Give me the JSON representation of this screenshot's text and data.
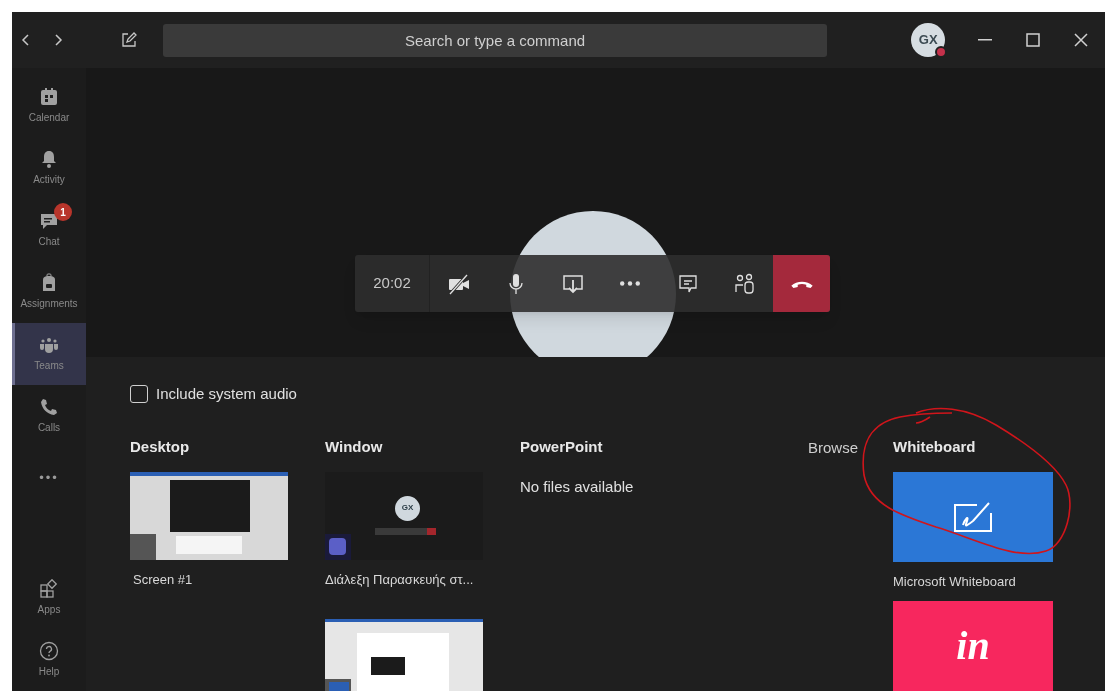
{
  "title_bar": {
    "search": {
      "placeholder": "Search or type a command"
    },
    "avatar": {
      "initials": "GX"
    }
  },
  "sidebar": {
    "items": [
      {
        "label": "Calendar",
        "selected": false
      },
      {
        "label": "Activity",
        "selected": false
      },
      {
        "label": "Chat",
        "selected": false,
        "badge": "1"
      },
      {
        "label": "Assignments",
        "selected": false
      },
      {
        "label": "Teams",
        "selected": true
      },
      {
        "label": "Calls",
        "selected": false
      },
      {
        "label": "•••",
        "selected": false
      }
    ],
    "bottom_items": [
      {
        "label": "Apps"
      },
      {
        "label": "Help"
      }
    ]
  },
  "call": {
    "toolbar": {
      "timer": "20:02",
      "buttons": [
        {
          "kind": "camera",
          "off": true
        },
        {
          "kind": "mic",
          "off": false
        },
        {
          "kind": "share"
        },
        {
          "kind": "more"
        },
        {
          "kind": "chat"
        },
        {
          "kind": "people"
        },
        {
          "kind": "hangup"
        }
      ]
    }
  },
  "share_tray": {
    "include_system_audio": {
      "label": "Include system audio",
      "checked": false
    },
    "desktop": {
      "title": "Desktop",
      "items": [
        {
          "label": "Screen #1",
          "kind": "screen"
        }
      ]
    },
    "window": {
      "title": "Window",
      "items": [
        {
          "label": "Διάλεξη Παρασκευής στ...",
          "kind": "teams",
          "avatar": "GX"
        },
        {
          "kind": "word"
        }
      ]
    },
    "powerpoint": {
      "title": "PowerPoint",
      "empty_text": "No files available"
    },
    "browse": {
      "label": "Browse"
    },
    "whiteboard": {
      "title": "Whiteboard",
      "items": [
        {
          "label": "Microsoft Whiteboard",
          "kind": "whiteboard",
          "color": "#2b77d6"
        },
        {
          "kind": "invision",
          "logo": "in",
          "color": "#f7275e"
        }
      ]
    },
    "annotation": {
      "color": "#d0151b"
    }
  }
}
